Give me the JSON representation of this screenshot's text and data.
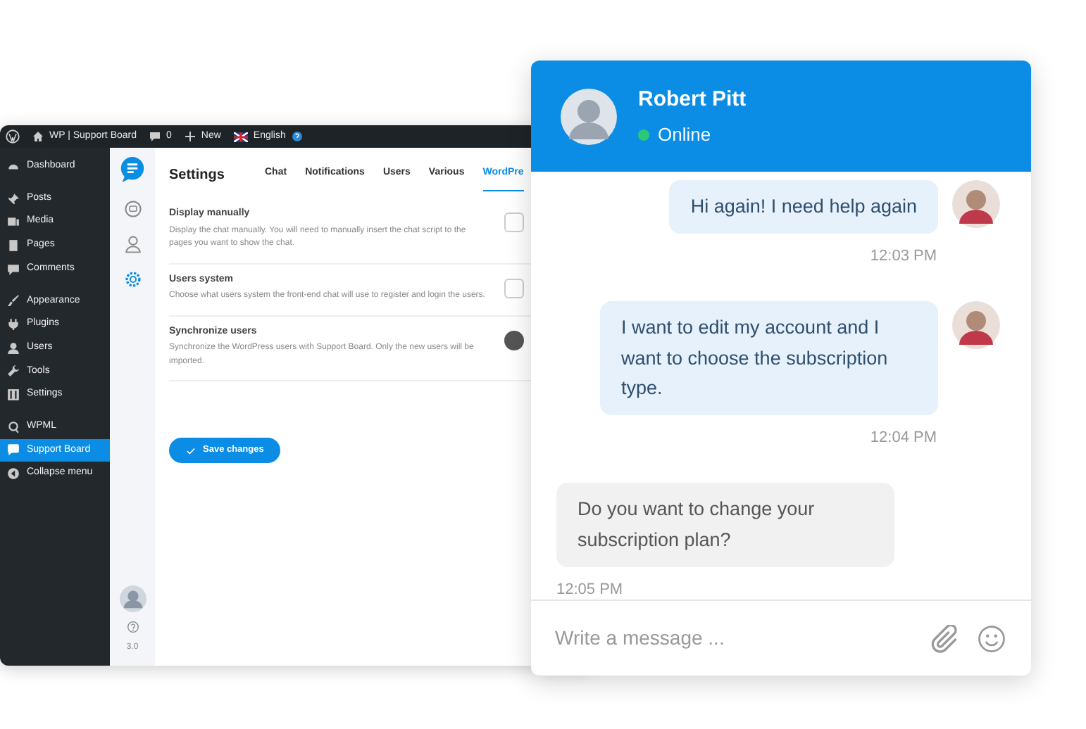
{
  "admin_bar": {
    "site": "WP | Support Board",
    "comments": "0",
    "new": "New",
    "language": "English"
  },
  "wp_menu": [
    [
      {
        "label": "Dashboard",
        "selected": false
      }
    ],
    [
      {
        "label": "Posts",
        "selected": false
      },
      {
        "label": "Media",
        "selected": false
      },
      {
        "label": "Pages",
        "selected": false
      },
      {
        "label": "Comments",
        "selected": false
      }
    ],
    [
      {
        "label": "Appearance",
        "selected": false
      },
      {
        "label": "Plugins",
        "selected": false
      },
      {
        "label": "Users",
        "selected": false
      },
      {
        "label": "Tools",
        "selected": false
      },
      {
        "label": "Settings",
        "selected": false
      }
    ],
    [
      {
        "label": "WPML",
        "selected": false
      },
      {
        "label": "Support Board",
        "selected": true
      },
      {
        "label": "Collapse menu",
        "selected": false
      }
    ]
  ],
  "rail": {
    "items": [
      {
        "selected": false
      },
      {
        "selected": false
      },
      {
        "selected": true
      }
    ],
    "version": "3.0"
  },
  "settings": {
    "title": "Settings",
    "tabs": [
      {
        "label": "Chat",
        "selected": false
      },
      {
        "label": "Notifications",
        "selected": false
      },
      {
        "label": "Users",
        "selected": false
      },
      {
        "label": "Various",
        "selected": false
      },
      {
        "label": "WordPre",
        "selected": true
      }
    ],
    "rows": [
      {
        "title": "Display manually",
        "description": "Display the chat manually. You will need to manually insert the chat script to the pages you want to show the chat.",
        "kind": "checkbox",
        "checked": false
      },
      {
        "title": "Users system",
        "description": "Choose what users system the front-end chat will use to register and login the users.",
        "kind": "select"
      },
      {
        "title": "Synchronize users",
        "description": "Synchronize the WordPress users with Support Board. Only the new users will be imported.",
        "kind": "button"
      }
    ],
    "save": "Save changes"
  },
  "chat": {
    "name": "Robert Pitt",
    "status": "Online",
    "messages": [
      {
        "kind": "sent",
        "text": "Hi again! I need help again",
        "time": "12:03 PM"
      },
      {
        "kind": "sent",
        "text": "I want to edit my account and I want to choose the subscription type.",
        "time": "12:04 PM"
      },
      {
        "kind": "received",
        "text": "Do you want to change your subscription plan?",
        "time": "12:05 PM"
      }
    ],
    "input": {
      "placeholder": "Write a message ..."
    }
  }
}
